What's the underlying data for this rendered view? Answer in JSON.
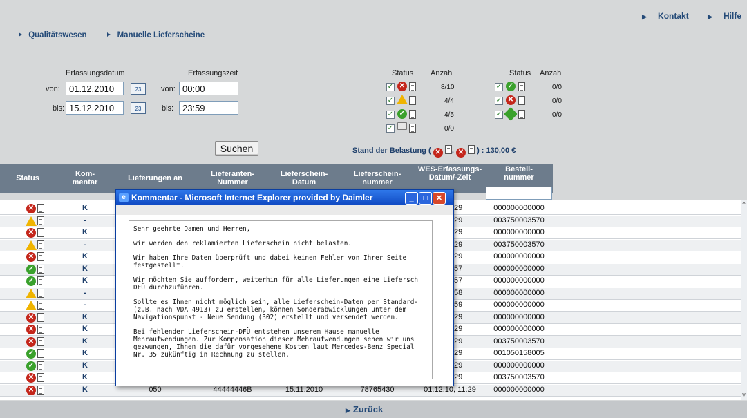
{
  "topnav": {
    "contact": "Kontakt",
    "help": "Hilfe"
  },
  "breadcrumb": {
    "level1": "Qualitätswesen",
    "level2": "Manuelle Lieferscheine"
  },
  "filter": {
    "date_label": "Erfassungsdatum",
    "time_label": "Erfassungszeit",
    "from_label": "von:",
    "to_label": "bis:",
    "date_from": "01.12.2010",
    "date_to": "15.12.2010",
    "time_from": "00:00",
    "time_to": "23:59",
    "search_button": "Suchen",
    "status_label": "Status",
    "count_label": "Anzahl",
    "status_left_counts": [
      "8/10",
      "4/4",
      "4/5",
      "0/0"
    ],
    "status_right_counts": [
      "0/0",
      "0/0",
      "0/0"
    ],
    "load_label": "Stand der Belastung (",
    "load_value": ") : 130,00 €"
  },
  "table": {
    "headers": [
      "Status",
      "Kom-\nmentar",
      "Lieferungen an",
      "Lieferanten-\nNummer",
      "Lieferschein-\nDatum",
      "Lieferschein-\nnummer",
      "WES-Erfassungs-\nDatum/-Zeit",
      "Bestell-\nnummer"
    ],
    "rows": [
      {
        "status": "red",
        "kom": "K",
        "wes": "), 11:29",
        "best": "000000000000"
      },
      {
        "status": "warn",
        "kom": "-",
        "wes": "), 11:29",
        "best": "003750003570"
      },
      {
        "status": "red",
        "kom": "K",
        "wes": "), 11:29",
        "best": "000000000000"
      },
      {
        "status": "warn",
        "kom": "-",
        "wes": "), 11:29",
        "best": "003750003570"
      },
      {
        "status": "red",
        "kom": "K",
        "wes": "), 11:29",
        "best": "000000000000"
      },
      {
        "status": "green",
        "kom": "K",
        "wes": "), 11:57",
        "best": "000000000000"
      },
      {
        "status": "green",
        "kom": "K",
        "wes": "), 11:57",
        "best": "000000000000"
      },
      {
        "status": "warn",
        "kom": "-",
        "wes": "), 11:58",
        "best": "000000000000"
      },
      {
        "status": "warn",
        "kom": "-",
        "wes": "), 11:59",
        "best": "000000000000"
      },
      {
        "status": "red",
        "kom": "K",
        "wes": "), 11:29",
        "best": "000000000000"
      },
      {
        "status": "red",
        "kom": "K",
        "wes": "), 11:29",
        "best": "000000000000"
      },
      {
        "status": "red",
        "kom": "K",
        "wes": "), 11:29",
        "best": "003750003570"
      },
      {
        "status": "green",
        "kom": "K",
        "wes": "), 11:29",
        "best": "001050158005"
      },
      {
        "status": "green",
        "kom": "K",
        "wes": "), 11:29",
        "best": "000000000000"
      },
      {
        "status": "red",
        "kom": "K",
        "wes": "), 11:29",
        "best": "003750003570"
      },
      {
        "status": "red",
        "kom": "K",
        "lief": "050",
        "liefnr": "44444446B",
        "datum": "15.11.2010",
        "lsnr": "78765430",
        "wes": "01.12.10, 11:29",
        "best": "000000000000"
      }
    ]
  },
  "footer": {
    "back": "Zurück"
  },
  "dialog": {
    "title": "Kommentar - Microsoft Internet Explorer provided by Daimler",
    "paragraphs": [
      "Sehr geehrte Damen und Herren,",
      "wir werden den reklamierten Lieferschein nicht belasten.",
      "Wir haben Ihre Daten überprüft und dabei keinen Fehler von Ihrer Seite festgestellt.",
      "Wir möchten Sie auffordern, weiterhin für alle Lieferungen eine Liefersch DFÜ durchzuführen.",
      "Sollte es Ihnen nicht möglich sein, alle Lieferschein-Daten per Standard-(z.B. nach VDA 4913) zu erstellen, können Sonderabwicklungen unter dem Navigationspunkt - Neue Sendung (302) erstellt und versendet werden.",
      "Bei fehlender Lieferschein-DFÜ entstehen unserem Hause manuelle Mehraufwendungen. Zur Kompensation dieser Mehraufwendungen sehen wir uns gezwungen, Ihnen die dafür vorgesehene Kosten laut Mercedes-Benz Special Nr. 35 zukünftig in Rechnung zu stellen."
    ]
  }
}
